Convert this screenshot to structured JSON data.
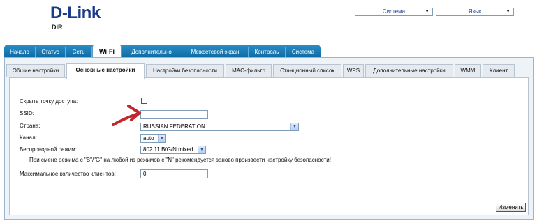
{
  "brand": {
    "logo": "D-Link",
    "subtitle": "DIR"
  },
  "top_menus": {
    "system": "Система",
    "language": "Язык"
  },
  "main_tabs": [
    {
      "label": "Начало",
      "active": false
    },
    {
      "label": "Статус",
      "active": false
    },
    {
      "label": "Сеть",
      "active": false
    },
    {
      "label": "Wi-Fi",
      "active": true
    },
    {
      "label": "Дополнительно",
      "active": false
    },
    {
      "label": "Межсетевой экран",
      "active": false
    },
    {
      "label": "Контроль",
      "active": false
    },
    {
      "label": "Система",
      "active": false
    }
  ],
  "sub_tabs": [
    {
      "label": "Общие настройки",
      "active": false
    },
    {
      "label": "Основные настройки",
      "active": true
    },
    {
      "label": "Настройки безопасности",
      "active": false
    },
    {
      "label": "MAC-фильтр",
      "active": false
    },
    {
      "label": "Станционный список",
      "active": false
    },
    {
      "label": "WPS",
      "active": false
    },
    {
      "label": "Дополнительные настройки",
      "active": false
    },
    {
      "label": "WMM",
      "active": false
    },
    {
      "label": "Клиент",
      "active": false
    }
  ],
  "form": {
    "hide_ap_label": "Скрыть точку доступа:",
    "hide_ap_checked": false,
    "ssid_label": "SSID:",
    "ssid_value": "",
    "country_label": "Страна:",
    "country_value": "RUSSIAN FEDERATION",
    "channel_label": "Канал:",
    "channel_value": "auto",
    "mode_label": "Беспроводной режим:",
    "mode_value": "802.11 B/G/N mixed",
    "mode_note": "При смене режима с \"B\"/\"G\" на любой из режимов с \"N\" рекомендуется заново произвести настройку безопасности!",
    "max_clients_label": "Максимальное количество клиентов:",
    "max_clients_value": "0"
  },
  "apply_label": "Изменить",
  "colors": {
    "tab_bar": "#0d6aa3",
    "logo": "#1a3a8c",
    "arrow": "#c0282d"
  }
}
